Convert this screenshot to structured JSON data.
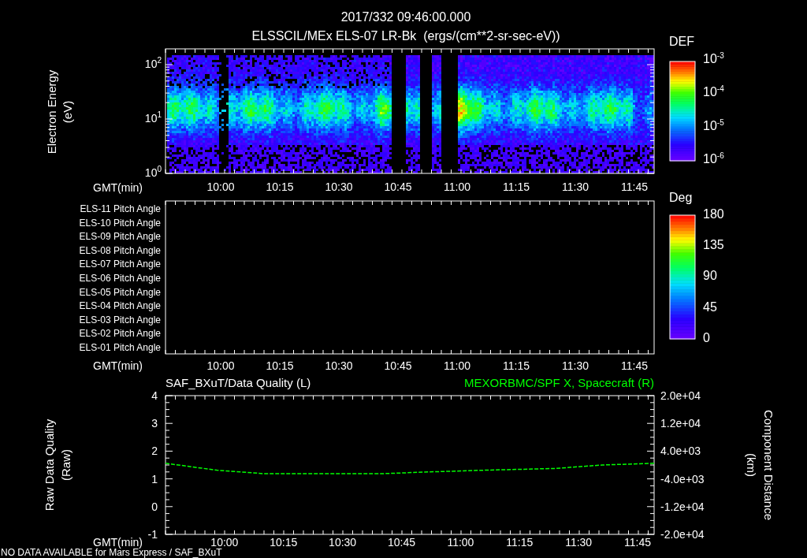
{
  "header": {
    "date_time": "2017/332 09:46:00.000",
    "title": "ELSSCIL/MEx ELS-07 LR-Bk  (ergs/(cm**2-sr-sec-eV))"
  },
  "energy_panel": {
    "ylabel": "Electron Energy",
    "yunit": "(eV)",
    "yticks": [
      "10$^{2}$",
      "10$^{1}$",
      "10$^{0}$"
    ],
    "x_axis_label": "GMT(min)",
    "time_labels": [
      "10:00",
      "10:15",
      "10:30",
      "10:45",
      "11:00",
      "11:15",
      "11:30",
      "11:45"
    ],
    "colorbar": {
      "title": "DEF",
      "labels": [
        "10$^{-3}$",
        "10$^{-4}$",
        "10$^{-5}$",
        "10$^{-6}$"
      ]
    }
  },
  "pitch_panel": {
    "rows": [
      "ELS-11 Pitch Angle",
      "ELS-10 Pitch Angle",
      "ELS-09 Pitch Angle",
      "ELS-08 Pitch Angle",
      "ELS-07 Pitch Angle",
      "ELS-06 Pitch Angle",
      "ELS-05 Pitch Angle",
      "ELS-04 Pitch Angle",
      "ELS-03 Pitch Angle",
      "ELS-02 Pitch Angle",
      "ELS-01 Pitch Angle"
    ],
    "x_axis_label": "GMT(min)",
    "time_labels": [
      "10:00",
      "10:15",
      "10:30",
      "10:45",
      "11:00",
      "11:15",
      "11:30",
      "11:45"
    ],
    "colorbar": {
      "title": "Deg",
      "labels": [
        "180",
        "135",
        "90",
        "45",
        "0"
      ]
    }
  },
  "quality_panel": {
    "left_title": "SAF_BXuT/Data Quality (L)",
    "left_ylabel": "Raw Data Quality",
    "left_yunit": "(Raw)",
    "left_yticks": [
      "4",
      "3",
      "2",
      "1",
      "0",
      "-1"
    ],
    "right_ylabel": "Component Distance",
    "right_yunit": "(km)",
    "chart_data": {
      "type": "line",
      "xlabel": "GMT(min)",
      "x": [
        9.75,
        9.967,
        10.167,
        10.4,
        10.667,
        10.867,
        11.1,
        11.4,
        11.6,
        11.82
      ],
      "xlim": [
        9.75,
        11.82
      ],
      "ylim": [
        -20000,
        20000
      ],
      "series": [
        {
          "name": "MEXORBMC/SPF X, Spacecraft (R)",
          "color": "#00ff00",
          "line_style": "dashed",
          "values": [
            500,
            -1500,
            -2500,
            -2500,
            -2500,
            -2000,
            -1500,
            -1000,
            0,
            500
          ]
        }
      ],
      "xticks": [
        {
          "value": 10,
          "label": "10:00"
        },
        {
          "value": 10.25,
          "label": "10:15"
        },
        {
          "value": 10.5,
          "label": "10:30"
        },
        {
          "value": 10.75,
          "label": "10:45"
        },
        {
          "value": 11,
          "label": "11:00"
        },
        {
          "value": 11.25,
          "label": "11:15"
        },
        {
          "value": 11.5,
          "label": "11:30"
        },
        {
          "value": 11.75,
          "label": "11:45"
        }
      ],
      "yticks": [
        {
          "value": 20000,
          "label": "2.0e+04"
        },
        {
          "value": 12000,
          "label": "1.2e+04"
        },
        {
          "value": 4000,
          "label": "4.0e+03"
        },
        {
          "value": -4000,
          "label": "-4.0e+03"
        },
        {
          "value": -12000,
          "label": "-1.2e+04"
        },
        {
          "value": -20000,
          "label": "-2.0e+04"
        }
      ]
    }
  },
  "footer": "NO DATA AVAILABLE for Mars Express / SAF_BXuT"
}
